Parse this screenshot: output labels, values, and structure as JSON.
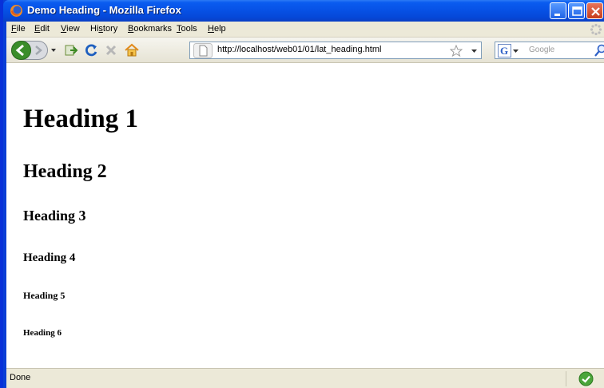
{
  "window": {
    "title": "Demo Heading - Mozilla Firefox"
  },
  "menu": {
    "items": [
      {
        "first": "F",
        "rest": "ile"
      },
      {
        "first": "E",
        "rest": "dit"
      },
      {
        "first": "V",
        "rest": "iew"
      },
      {
        "first": "Hi",
        "rest": "s",
        "tail": "tory"
      },
      {
        "first": "B",
        "rest": "ookmarks"
      },
      {
        "first": "T",
        "rest": "ools"
      },
      {
        "first": "H",
        "rest": "elp"
      }
    ]
  },
  "nav": {
    "url": "http://localhost/web01/01/lat_heading.html",
    "search_placeholder": "Google"
  },
  "page": {
    "headings": [
      "Heading 1",
      "Heading 2",
      "Heading 3",
      "Heading 4",
      "Heading 5",
      "Heading 6"
    ]
  },
  "status": {
    "text": "Done"
  },
  "colors": {
    "titlebar": "#0752e6",
    "chrome": "#ece9d8",
    "close": "#c63d1b"
  }
}
